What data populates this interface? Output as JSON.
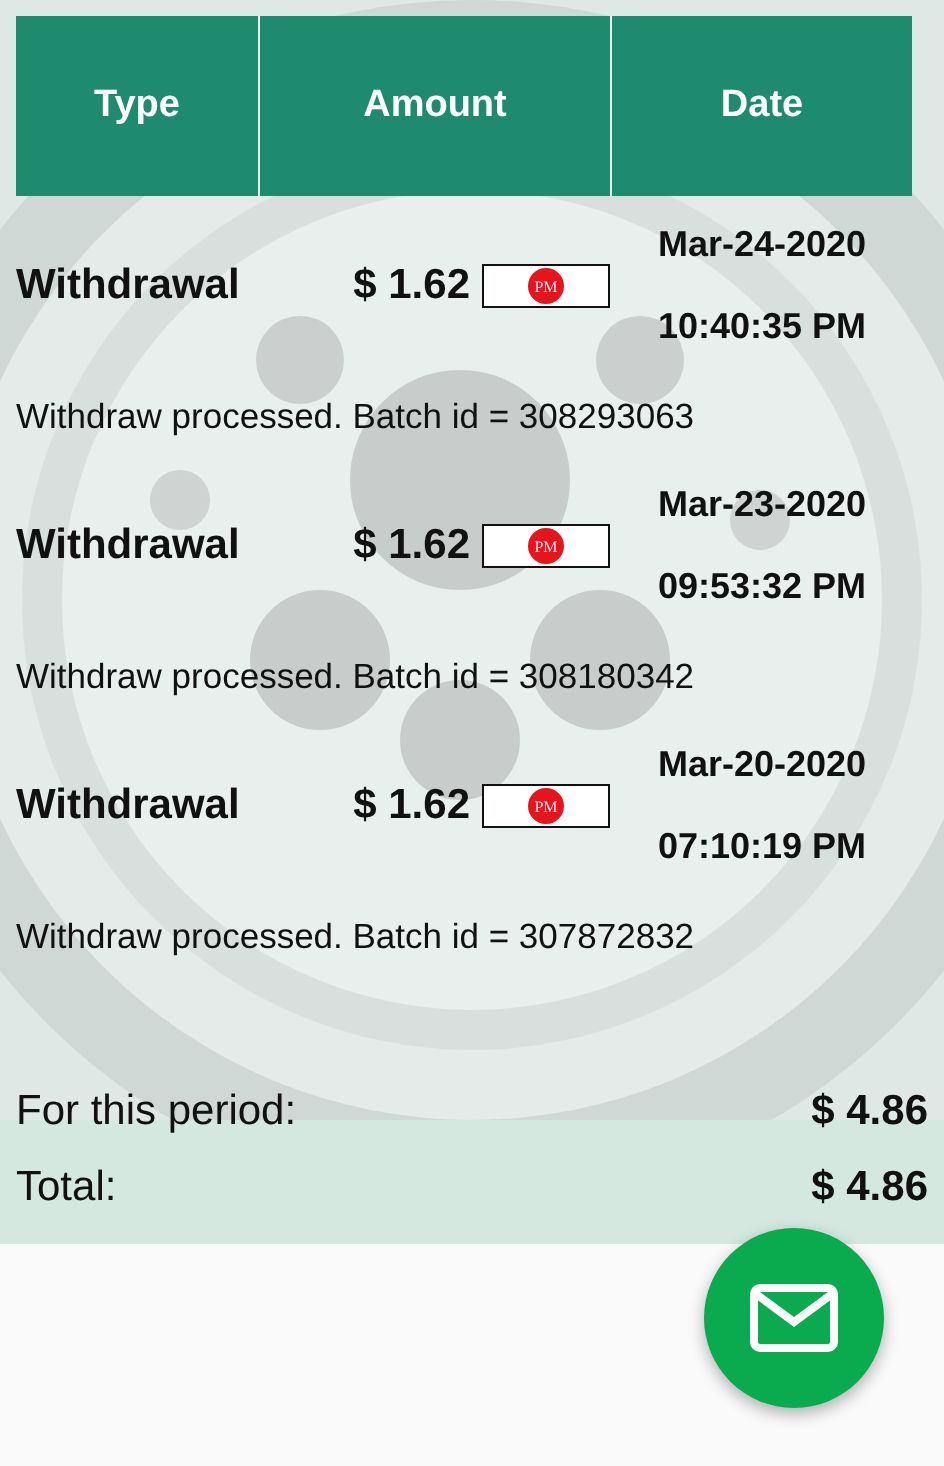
{
  "table": {
    "columns": [
      "Type",
      "Amount",
      "Date"
    ],
    "rows": [
      {
        "type": "Withdrawal",
        "amount": "$ 1.62",
        "method": "PM",
        "date": "Mar-24-2020",
        "time": "10:40:35 PM",
        "note": "Withdraw processed. Batch id = 308293063"
      },
      {
        "type": "Withdrawal",
        "amount": "$ 1.62",
        "method": "PM",
        "date": "Mar-23-2020",
        "time": "09:53:32 PM",
        "note": "Withdraw processed. Batch id = 308180342"
      },
      {
        "type": "Withdrawal",
        "amount": "$ 1.62",
        "method": "PM",
        "date": "Mar-20-2020",
        "time": "07:10:19 PM",
        "note": "Withdraw processed. Batch id = 307872832"
      }
    ]
  },
  "summary": [
    {
      "label": "For this period:",
      "value": "$ 4.86"
    },
    {
      "label": "Total:",
      "value": "$ 4.86"
    }
  ]
}
